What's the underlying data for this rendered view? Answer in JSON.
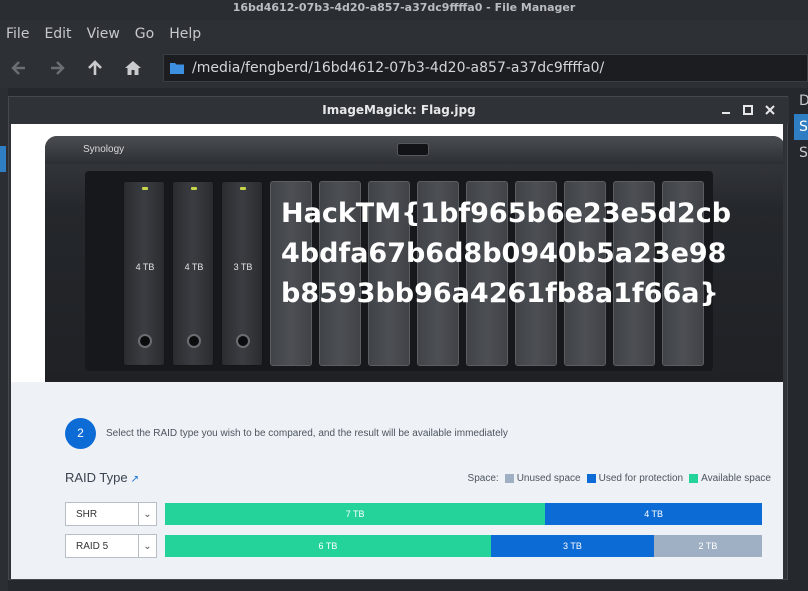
{
  "window_title": "16bd4612-07b3-4d20-a857-a37dc9ffffa0 - File Manager",
  "menu": [
    "File",
    "Edit",
    "View",
    "Go",
    "Help"
  ],
  "path": "/media/fengberd/16bd4612-07b3-4d20-a857-a37dc9ffffa0/",
  "right_column": [
    "D",
    "S",
    "S"
  ],
  "image_window": {
    "title": "ImageMagick: Flag.jpg"
  },
  "nas": {
    "brand": "Synology",
    "drives": [
      "4 TB",
      "4 TB",
      "3 TB"
    ],
    "flag_lines": [
      "HackTM{1bf965b6e23e5d2cb",
      "4bdfa67b6d8b0940b5a23e98",
      "b8593bb96a4261fb8a1f66a}"
    ]
  },
  "raid": {
    "step_number": "2",
    "step_text": "Select the RAID type you wish to be compared, and the result will be available immediately",
    "raid_type_label": "RAID Type",
    "legend": {
      "title": "Space:",
      "items": [
        {
          "label": "Unused space",
          "color": "#9fb0c4"
        },
        {
          "label": "Used for protection",
          "color": "#0d6bd6"
        },
        {
          "label": "Available space",
          "color": "#24d399"
        }
      ]
    },
    "rows": [
      {
        "type": "SHR",
        "segments": [
          {
            "label": "7 TB",
            "fraction": 0.637,
            "color": "#24d399"
          },
          {
            "label": "4 TB",
            "fraction": 0.363,
            "color": "#0d6bd6"
          }
        ]
      },
      {
        "type": "RAID 5",
        "segments": [
          {
            "label": "6 TB",
            "fraction": 0.546,
            "color": "#24d399"
          },
          {
            "label": "3 TB",
            "fraction": 0.273,
            "color": "#0d6bd6"
          },
          {
            "label": "2 TB",
            "fraction": 0.181,
            "color": "#9fb0c4"
          }
        ]
      }
    ]
  }
}
